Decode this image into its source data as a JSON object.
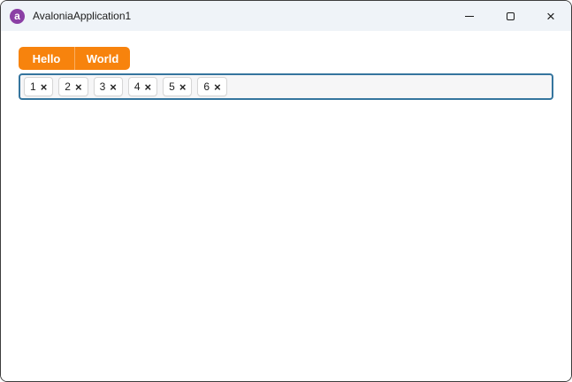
{
  "window": {
    "title": "AvaloniaApplication1",
    "logo_glyph": "a",
    "controls": [
      {
        "name": "minimize"
      },
      {
        "name": "maximize"
      },
      {
        "name": "close",
        "glyph": "×"
      }
    ]
  },
  "colors": {
    "accent_orange": "#F7830D",
    "logo_purple": "#8B3FA5",
    "chipbox_focus_border": "#35759E",
    "titlebar_bg": "#EFF3F8",
    "window_border": "#3D3D3D"
  },
  "toolbar": {
    "buttons": [
      {
        "label": "Hello"
      },
      {
        "label": "World"
      }
    ]
  },
  "chipbox": {
    "remove_glyph": "×",
    "chips": [
      {
        "label": "1"
      },
      {
        "label": "2"
      },
      {
        "label": "3"
      },
      {
        "label": "4"
      },
      {
        "label": "5"
      },
      {
        "label": "6"
      }
    ]
  }
}
